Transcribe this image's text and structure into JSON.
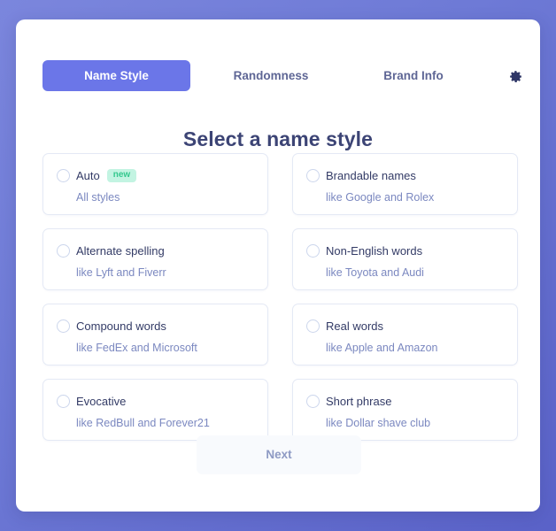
{
  "tabs": [
    {
      "label": "Name Style",
      "active": true
    },
    {
      "label": "Randomness",
      "active": false
    },
    {
      "label": "Brand Info",
      "active": false
    }
  ],
  "settings_icon": "gear-icon",
  "heading": "Select a name style",
  "options": [
    {
      "title": "Auto",
      "badge": "new",
      "subtitle": "All styles",
      "selected": false
    },
    {
      "title": "Brandable names",
      "badge": "",
      "subtitle": "like Google and Rolex",
      "selected": false
    },
    {
      "title": "Alternate spelling",
      "badge": "",
      "subtitle": "like Lyft and Fiverr",
      "selected": false
    },
    {
      "title": "Non-English words",
      "badge": "",
      "subtitle": "like Toyota and Audi",
      "selected": false
    },
    {
      "title": "Compound words",
      "badge": "",
      "subtitle": "like FedEx and Microsoft",
      "selected": false
    },
    {
      "title": "Real words",
      "badge": "",
      "subtitle": "like Apple and Amazon",
      "selected": false
    },
    {
      "title": "Evocative",
      "badge": "",
      "subtitle": "like RedBull and Forever21",
      "selected": false
    },
    {
      "title": "Short phrase",
      "badge": "",
      "subtitle": "like Dollar shave club",
      "selected": false
    }
  ],
  "next_button": {
    "label": "Next",
    "disabled": true
  },
  "colors": {
    "accent": "#6b76e8",
    "background_gradient_start": "#7b86dd",
    "background_gradient_end": "#5a62c8",
    "title_text": "#333b66",
    "subtitle_text": "#7b88c0",
    "badge_background": "#c3f4e2",
    "badge_text": "#34c88e",
    "card_border": "#e4e9f5",
    "next_background": "#f8fafd",
    "next_text": "#8e9ac4"
  }
}
